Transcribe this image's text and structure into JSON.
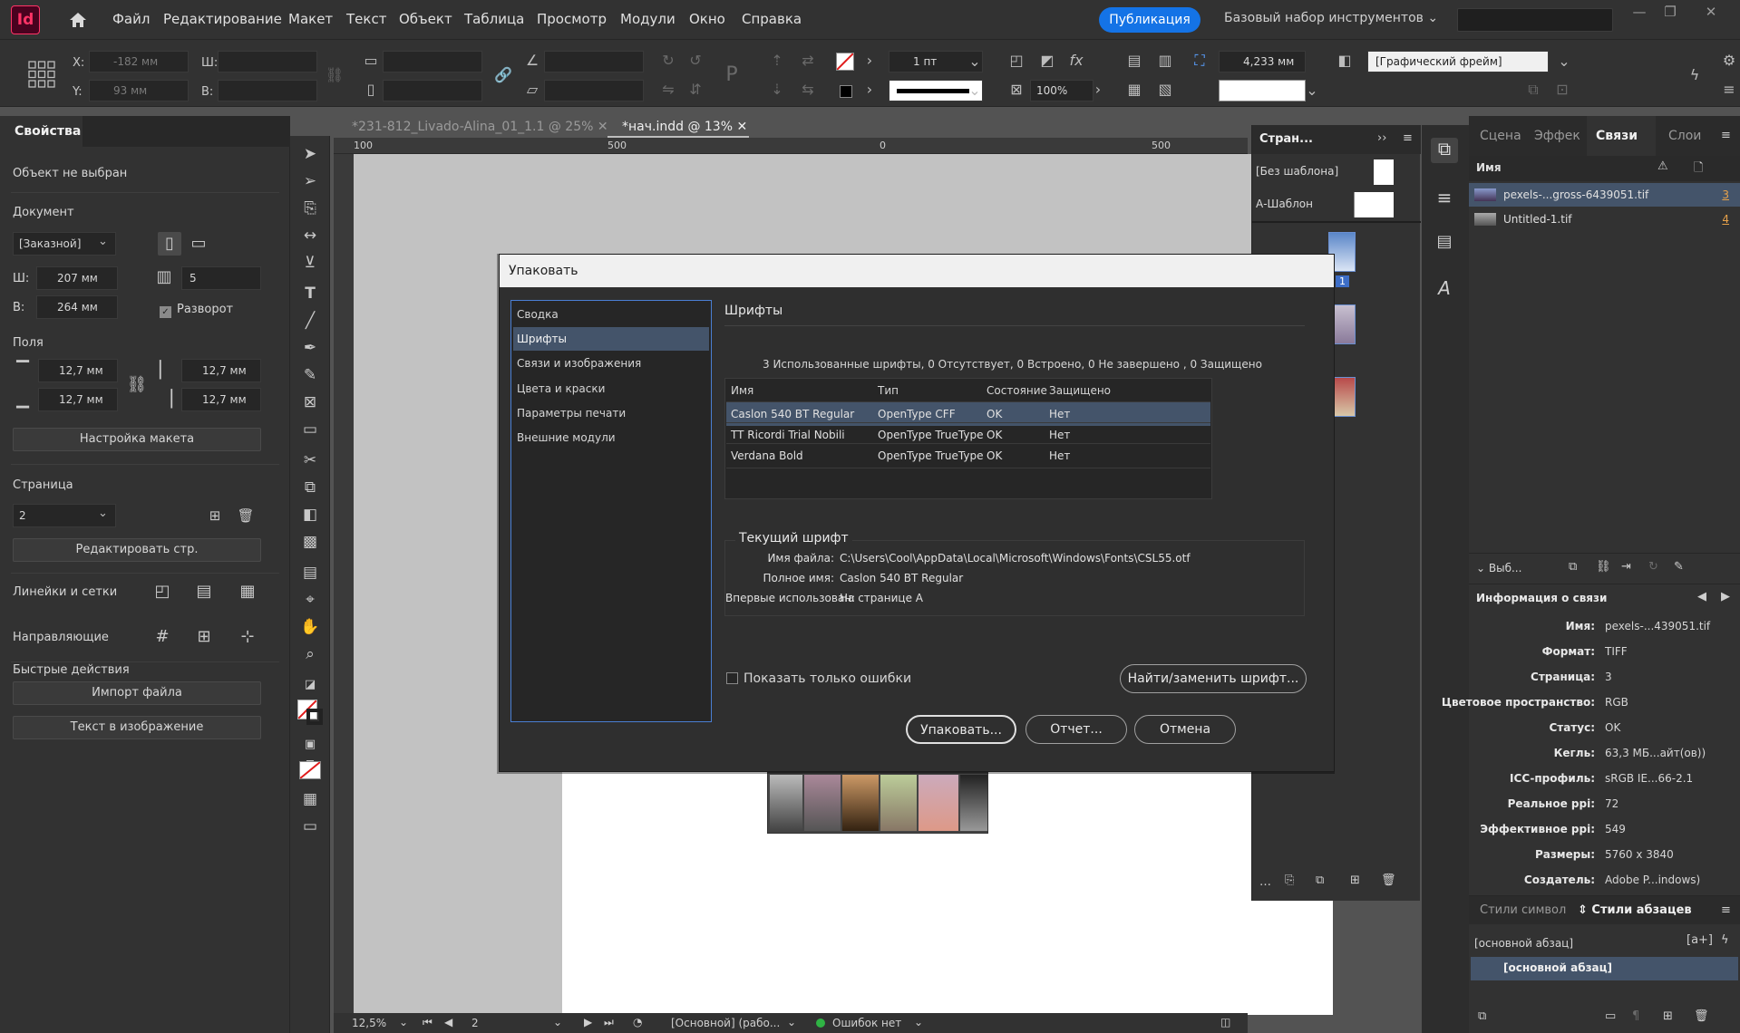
{
  "app": {
    "logo": "Id",
    "menu": [
      "Файл",
      "Редактирование",
      "Макет",
      "Текст",
      "Объект",
      "Таблица",
      "Просмотр",
      "Модули",
      "Окно",
      "Справка"
    ],
    "publish_label": "Публикация",
    "workspace_label": "Базовый набор инструментов"
  },
  "controlbar": {
    "x_label": "X:",
    "y_label": "Y:",
    "w_label": "Ш:",
    "h_label": "В:",
    "x_value": "-182 мм",
    "y_value": "93 мм",
    "stroke_weight": "1 пт",
    "opacity": "100%",
    "gutter": "4,233 мм",
    "frame_type": "[Графический фрейм]"
  },
  "tabs": {
    "doc1": "*231-812_Livado-Alina_01_1.1 @ 25%",
    "doc2": "*нач.indd @ 13%"
  },
  "properties": {
    "tab": "Свойства",
    "no_selection": "Объект не выбран",
    "document_label": "Документ",
    "preset": "[Заказной]",
    "w_label": "Ш:",
    "w_value": "207 мм",
    "h_label": "В:",
    "h_value": "264 мм",
    "pages_count": "5",
    "facing_label": "Разворот",
    "margins_label": "Поля",
    "margin_top": "12,7 мм",
    "margin_bottom": "12,7 мм",
    "margin_left": "12,7 мм",
    "margin_right": "12,7 мм",
    "layout_setup": "Настройка макета",
    "page_label": "Страница",
    "page_value": "2",
    "edit_page": "Редактировать стр.",
    "rulers_label": "Линейки и сетки",
    "guides_label": "Направляющие",
    "quick_actions": "Быстрые действия",
    "import_file": "Импорт файла",
    "text_in_image": "Текст в изображение"
  },
  "rulers": {
    "h1": "100",
    "h2": "500",
    "h3": "0",
    "h4": "500"
  },
  "statusbar": {
    "zoom": "12,5%",
    "page": "2",
    "preflight_profile": "[Основной] (рабо...",
    "errors": "Ошибок нет"
  },
  "pages_panel": {
    "title": "Стран...",
    "no_master": "[Без шаблона]",
    "a_master": "А-Шаблон",
    "page1_label": "1"
  },
  "links_panel": {
    "tabs": [
      "Сцена",
      "Эффек",
      "Связи",
      "Слои"
    ],
    "col_name": "Имя",
    "links": [
      {
        "name": "pexels-...gross-6439051.tif",
        "page": "3"
      },
      {
        "name": "Untitled-1.tif",
        "page": "4"
      }
    ],
    "select_label": "Выб...",
    "info_title": "Информация о связи",
    "info": [
      {
        "label": "Имя:",
        "value": "pexels-...439051.tif"
      },
      {
        "label": "Формат:",
        "value": "TIFF"
      },
      {
        "label": "Страница:",
        "value": "3"
      },
      {
        "label": "Цветовое пространство:",
        "value": "RGB"
      },
      {
        "label": "Статус:",
        "value": "OK"
      },
      {
        "label": "Кегль:",
        "value": "63,3 МБ...айт(ов))"
      },
      {
        "label": "ICC-профиль:",
        "value": "sRGB IE...66-2.1"
      },
      {
        "label": "Реальное ppi:",
        "value": "72"
      },
      {
        "label": "Эффективное ppi:",
        "value": "549"
      },
      {
        "label": "Размеры:",
        "value": "5760 x 3840"
      },
      {
        "label": "Создатель:",
        "value": "Adobe P...indows)"
      }
    ],
    "styles_tabs": [
      "Стили символ",
      "Стили абзацев"
    ],
    "style_current": "[основной абзац]",
    "style_selected": "[основной абзац]"
  },
  "dialog": {
    "title": "Упаковать",
    "nav": [
      "Сводка",
      "Шрифты",
      "Связи и изображения",
      "Цвета и краски",
      "Параметры печати",
      "Внешние модули"
    ],
    "section_title": "Шрифты",
    "summary": "3 Использованные шрифты, 0 Отсутствует, 0 Встроено, 0 Не завершено , 0 Защищено",
    "columns": [
      "Имя",
      "Тип",
      "Состояние",
      "Защищено"
    ],
    "rows": [
      {
        "name": "Caslon 540 BT Regular",
        "type": "OpenType CFF",
        "status": "OK",
        "protected": "Нет"
      },
      {
        "name": "TT Ricordi Trial Nobili",
        "type": "OpenType TrueType",
        "status": "OK",
        "protected": "Нет"
      },
      {
        "name": "Verdana Bold",
        "type": "OpenType TrueType",
        "status": "OK",
        "protected": "Нет"
      }
    ],
    "current_font_title": "Текущий шрифт",
    "file_name_label": "Имя файла:",
    "file_name_value": "C:\\Users\\Cool\\AppData\\Local\\Microsoft\\Windows\\Fonts\\CSL55.otf",
    "full_name_label": "Полное имя:",
    "full_name_value": "Caslon 540 BT Regular",
    "first_used_label": "Впервые использован:",
    "first_used_value": "На странице A",
    "errors_only": "Показать только ошибки",
    "find_replace": "Найти/заменить шрифт...",
    "package_btn": "Упаковать...",
    "report_btn": "Отчет...",
    "cancel_btn": "Отмена"
  }
}
